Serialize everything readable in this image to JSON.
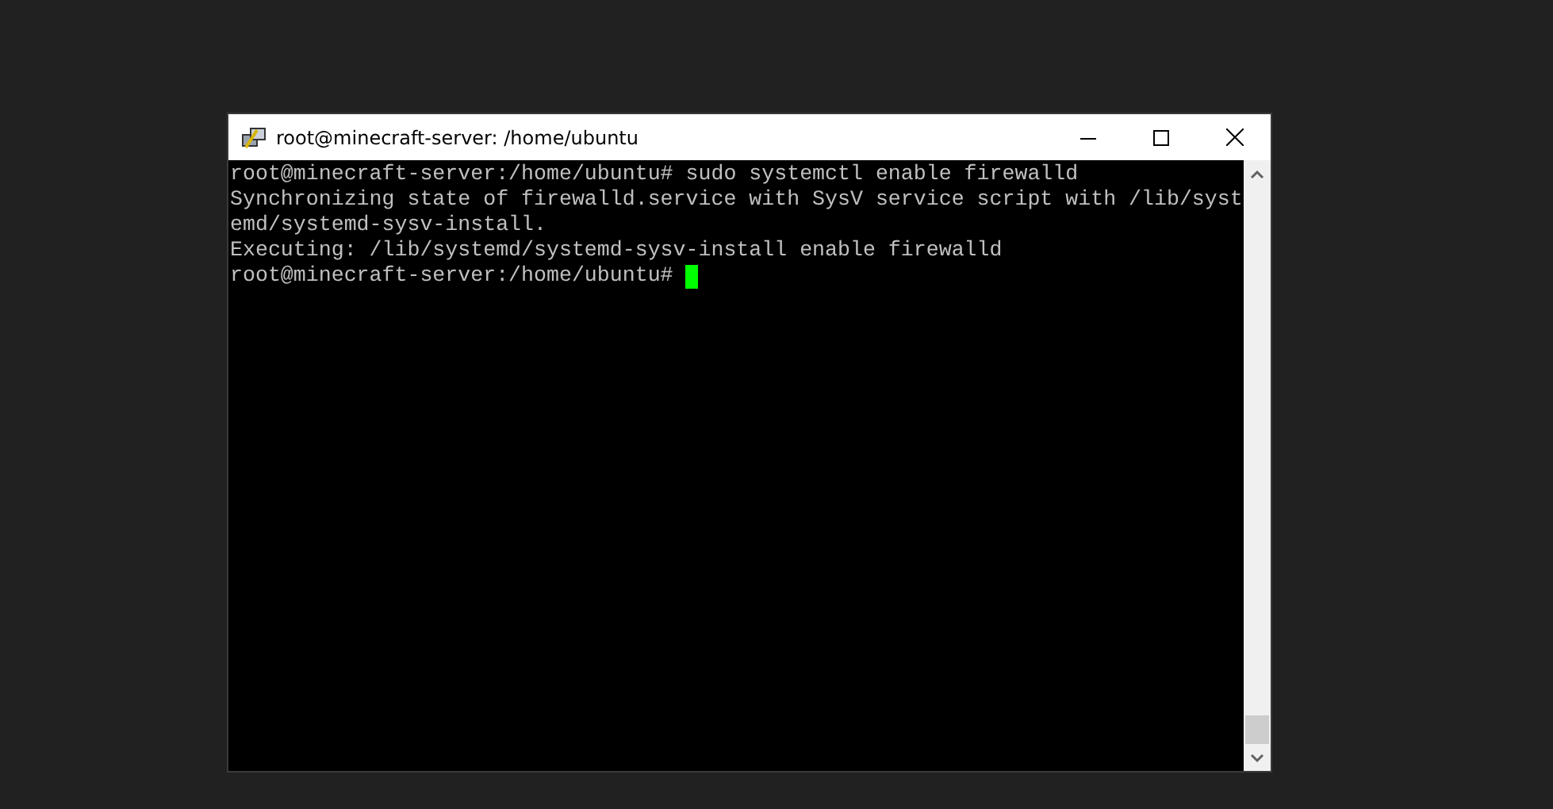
{
  "window": {
    "title": "root@minecraft-server: /home/ubuntu"
  },
  "terminal": {
    "lines": [
      "root@minecraft-server:/home/ubuntu# sudo systemctl enable firewalld",
      "Synchronizing state of firewalld.service with SysV service script with /lib/syst",
      "emd/systemd-sysv-install.",
      "Executing: /lib/systemd/systemd-sysv-install enable firewalld",
      "root@minecraft-server:/home/ubuntu# "
    ]
  }
}
